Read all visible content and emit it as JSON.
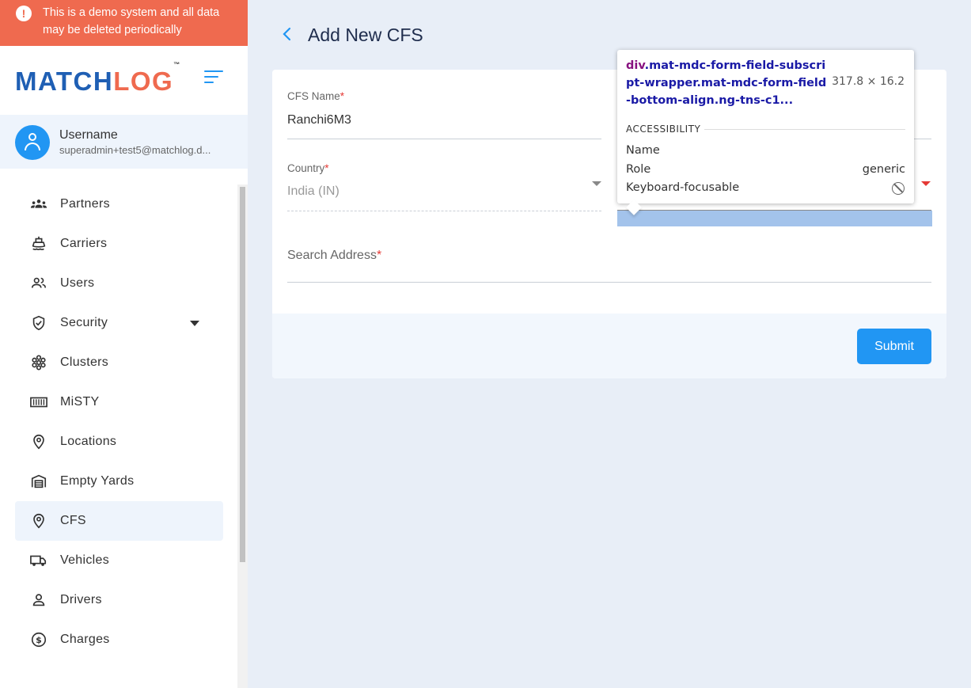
{
  "banner": {
    "text": "This is a demo system and all data may be deleted periodically"
  },
  "logo": {
    "part1": "MATCH",
    "part2": "LOG",
    "tm": "™"
  },
  "user": {
    "name": "Username",
    "email": "superadmin+test5@matchlog.d..."
  },
  "sidebar": {
    "items": [
      {
        "label": "Partners",
        "icon": "partners-icon"
      },
      {
        "label": "Carriers",
        "icon": "ship-icon"
      },
      {
        "label": "Users",
        "icon": "users-icon"
      },
      {
        "label": "Security",
        "icon": "shield-icon",
        "expandable": true
      },
      {
        "label": "Clusters",
        "icon": "clusters-icon"
      },
      {
        "label": "MiSTY",
        "icon": "container-icon"
      },
      {
        "label": "Locations",
        "icon": "location-pin-icon"
      },
      {
        "label": "Empty Yards",
        "icon": "warehouse-icon"
      },
      {
        "label": "CFS",
        "icon": "location-pin-icon",
        "active": true
      },
      {
        "label": "Vehicles",
        "icon": "truck-icon"
      },
      {
        "label": "Drivers",
        "icon": "person-icon"
      },
      {
        "label": "Charges",
        "icon": "dollar-circle-icon"
      }
    ]
  },
  "page": {
    "title": "Add New CFS"
  },
  "form": {
    "cfs_name_label": "CFS Name",
    "cfs_name_value": "Ranchi6M3",
    "country_label": "Country",
    "country_value": "India (IN)",
    "search_address_label": "Search Address",
    "required_mark": "*",
    "submit_label": "Submit"
  },
  "devtools_tooltip": {
    "tag": "div",
    "selector": ".mat-mdc-form-field-subscript-wrapper.mat-mdc-form-field-bottom-align.ng-tns-c1...",
    "dimensions": "317.8 × 16.2",
    "section": "ACCESSIBILITY",
    "name_key": "Name",
    "role_key": "Role",
    "role_value": "generic",
    "focus_key": "Keyboard-focusable"
  },
  "colors": {
    "accent": "#2196f3",
    "brand_blue": "#1f5fb4",
    "brand_orange": "#ef6a4f",
    "required": "#e53935",
    "highlight": "#a3c3eb"
  }
}
